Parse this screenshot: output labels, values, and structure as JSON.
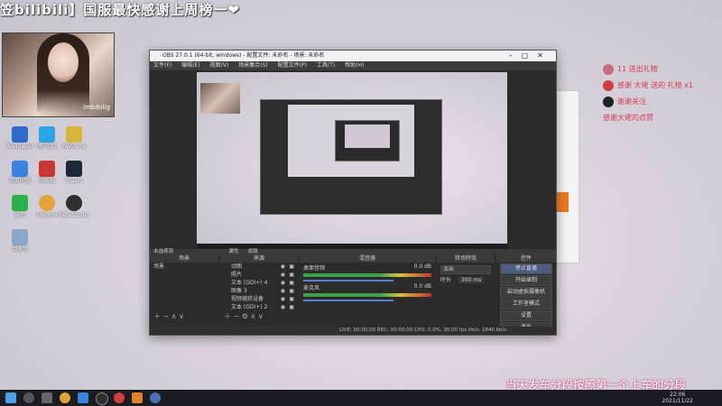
{
  "stream_title": "笠bilibili】国服最快感谢上周榜一❤【三",
  "webcam_watermark": "imbibilig",
  "obs": {
    "title": "OBS 27.0.1 (64-bit, windows) - 配置文件: 未命名 - 场景: 未命名",
    "menu": [
      "文件(F)",
      "编辑(E)",
      "视图(V)",
      "场景集合(S)",
      "配置文件(P)",
      "工具(T)",
      "帮助(H)"
    ],
    "no_source_selected": "未选择源",
    "properties_label": "属性",
    "filters_label": "滤镜",
    "docks": {
      "scenes": "场景",
      "sources": "来源",
      "mixer": "混音器",
      "transitions": "转场特效",
      "controls": "控件"
    },
    "scene_items": [
      "场景"
    ],
    "sources": [
      "动图",
      "照片",
      "文本 (GDI+) 4",
      "图像 3",
      "视频捕获设备",
      "文本 (GDI+) 2"
    ],
    "mixer_channels": [
      {
        "name": "桌面音频",
        "value": "0.0 dB"
      },
      {
        "name": "麦克风",
        "value": "0.0 dB"
      }
    ],
    "transition": {
      "type": "淡出",
      "duration_label": "时长",
      "duration_value": "300 ms"
    },
    "controls": [
      "停止直播",
      "开始录制",
      "启动虚拟摄像机",
      "工作室模式",
      "设置",
      "退出"
    ],
    "status": "LIVE: 00:00:00   REC: 00:00:00   CPU: 0.0%, 30.00 fps   kb/s: 1840 kb/s"
  },
  "chat": [
    {
      "text": "11 送出礼物",
      "color": "#e14d63"
    },
    {
      "text": "感谢 大佬 送的 礼物 x1",
      "color": "#e14d63"
    },
    {
      "text": "谢谢关注",
      "color": "#e14d63"
    },
    {
      "text": "感谢大佬的点赞",
      "color": "#e14d63"
    }
  ],
  "subtitle": "当天发车分段按照第一个上车的分段",
  "clock": {
    "time": "22:06",
    "date": "2021/11/22"
  },
  "desktop_icons": [
    {
      "label": "Wallpaper",
      "color": "#2d6ccf"
    },
    {
      "label": "腾讯QQ",
      "color": "#2aa6e8"
    },
    {
      "label": "WeGame",
      "color": "#d7b73b"
    },
    {
      "label": "百度网盘",
      "color": "#3b83e0"
    },
    {
      "label": "网易云",
      "color": "#c93634"
    },
    {
      "label": "Steam",
      "color": "#1b2838"
    },
    {
      "label": "微信",
      "color": "#2bb14b"
    },
    {
      "label": "Chrome",
      "color": "#e2a33a"
    },
    {
      "label": "OBS Studio",
      "color": "#2f2f2f"
    },
    {
      "label": "回收站",
      "color": "#8aa7c9"
    }
  ]
}
